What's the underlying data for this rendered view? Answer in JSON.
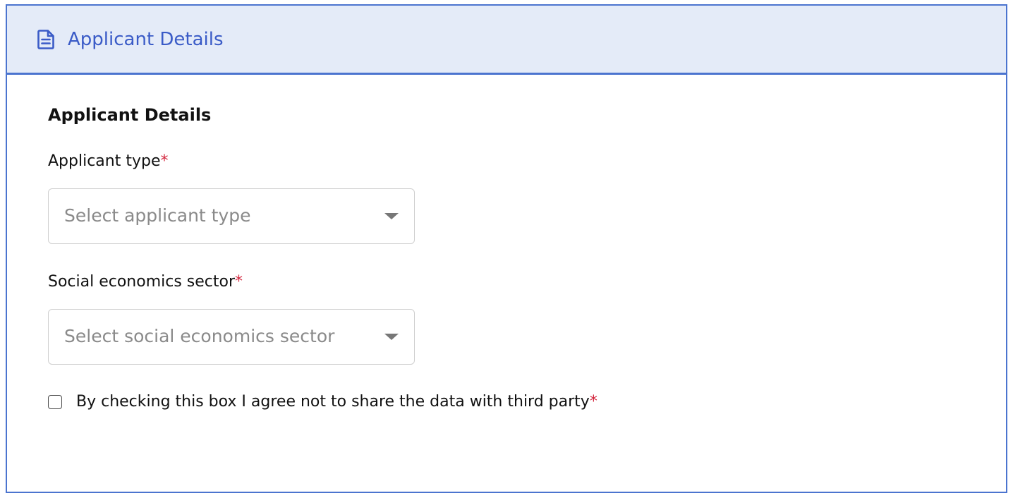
{
  "header": {
    "icon": "document-icon",
    "title": "Applicant Details",
    "accent_color": "#4b74cf",
    "background_color": "#e4ebf8"
  },
  "form": {
    "section_title": "Applicant Details",
    "fields": [
      {
        "label": "Applicant type",
        "required_mark": "*",
        "placeholder": "Select applicant type",
        "value": ""
      },
      {
        "label": "Social economics sector",
        "required_mark": "*",
        "placeholder": "Select social economics sector",
        "value": ""
      }
    ],
    "agreement": {
      "label": "By checking this box I agree not to share the data with third party",
      "required_mark": "*",
      "checked": false
    },
    "required_color": "#d3273e"
  }
}
